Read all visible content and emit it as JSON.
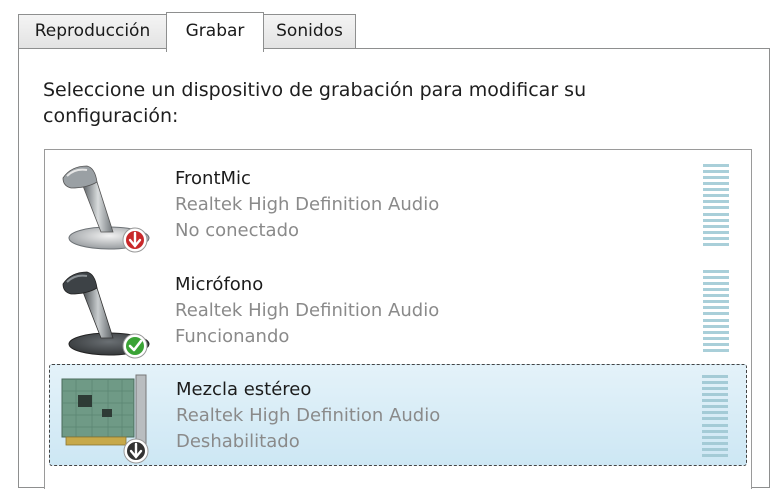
{
  "tabs": [
    {
      "label": "Reproducción",
      "selected": false
    },
    {
      "label": "Grabar",
      "selected": true
    },
    {
      "label": "Sonidos",
      "selected": false
    }
  ],
  "instruction": "Seleccione un dispositivo de grabación para modificar su configuración:",
  "devices": [
    {
      "name": "FrontMic",
      "driver": "Realtek High Definition Audio",
      "status": "No conectado",
      "icon": "microphone-icon",
      "status_icon": "red-down-arrow-icon",
      "selected": false,
      "level": 0
    },
    {
      "name": "Micrófono",
      "driver": "Realtek High Definition Audio",
      "status": "Funcionando",
      "icon": "microphone-icon",
      "status_icon": "green-check-icon",
      "selected": false,
      "level": 0
    },
    {
      "name": "Mezcla estéreo",
      "driver": "Realtek High Definition Audio",
      "status": "Deshabilitado",
      "icon": "sound-card-icon",
      "status_icon": "disabled-down-arrow-icon",
      "selected": true,
      "level": 0
    }
  ],
  "colors": {
    "selected_row": "#cde7f4",
    "meter_segment": "#a9cfd9",
    "status_red": "#c8282a",
    "status_green": "#3aa335"
  }
}
